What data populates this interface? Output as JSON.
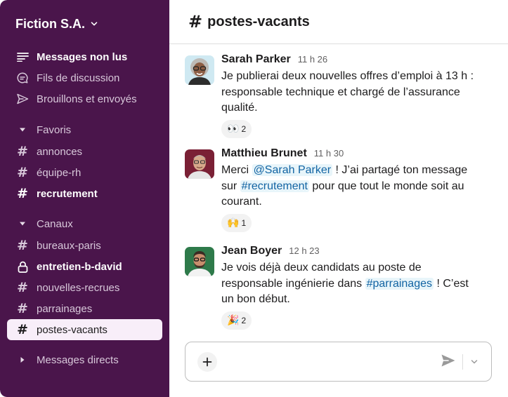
{
  "workspace": {
    "name": "Fiction S.A."
  },
  "sidebar": {
    "nav": [
      {
        "label": "Messages non lus",
        "icon": "unread-messages-icon"
      },
      {
        "label": "Fils de discussion",
        "icon": "threads-icon"
      },
      {
        "label": "Brouillons et envoyés",
        "icon": "send-icon"
      }
    ],
    "favoris": {
      "label": "Favoris",
      "channels": [
        "annonces",
        "équipe-rh",
        "recrutement"
      ]
    },
    "canaux": {
      "label": "Canaux",
      "channels": [
        "bureaux-paris",
        "entretien-b-david",
        "nouvelles-recrues",
        "parrainages",
        "postes-vacants"
      ]
    },
    "dms": {
      "label": "Messages directs"
    }
  },
  "channel": {
    "name": "postes-vacants"
  },
  "messages": [
    {
      "author": "Sarah Parker",
      "time": "11 h 26",
      "line1": "Je publierai deux nouvelles offres d’emploi à 13 h :",
      "line2": "responsable technique et chargé de l’assurance",
      "line3": "qualité.",
      "reaction": {
        "emoji": "👀",
        "count": "2"
      }
    },
    {
      "author": "Matthieu Brunet",
      "time": "11 h 30",
      "pre": "Merci ",
      "mention": "@Sarah Parker",
      "mid": " ! J’ai partagé ton message",
      "pre2": "sur ",
      "channel_link": "#recrutement",
      "post2": " pour que tout le monde soit au",
      "line3": "courant.",
      "reaction": {
        "emoji": "🙌",
        "count": "1"
      }
    },
    {
      "author": "Jean Boyer",
      "time": "12 h 23",
      "line1": "Je vois déjà deux candidats au poste de",
      "pre2": "responsable ingénierie dans ",
      "channel_link": "#parrainages",
      "post2": " ! C’est",
      "line3": "un bon début.",
      "reaction": {
        "emoji": "🎉",
        "count": "2"
      }
    }
  ],
  "composer": {
    "placeholder": ""
  }
}
